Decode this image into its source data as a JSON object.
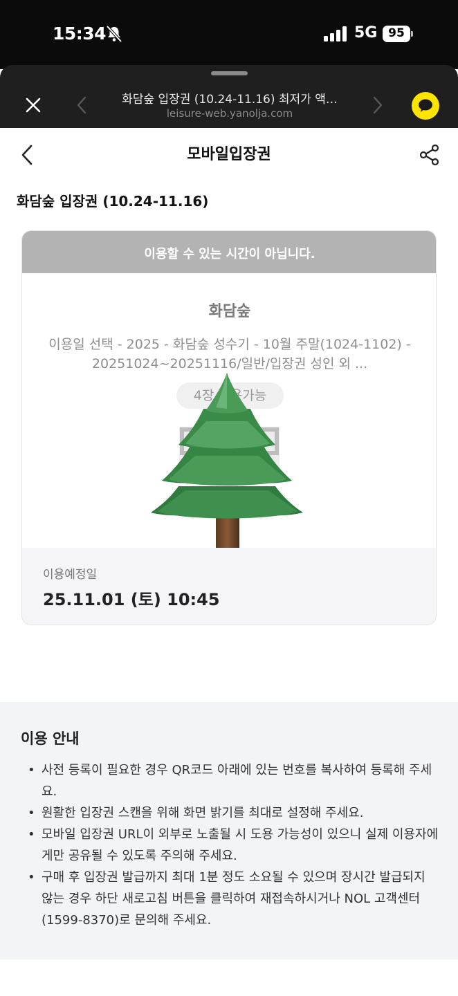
{
  "status_bar": {
    "time": "15:34",
    "network": "5G",
    "battery": "95"
  },
  "browser": {
    "title": "화담숲 입장권 (10.24-11.16) 최저가 액…",
    "url": "leisure-web.yanolja.com",
    "icons": [
      "close-icon",
      "chevron-left-icon",
      "chevron-right-icon",
      "kakao-chat-icon"
    ],
    "accent": "#fee500"
  },
  "header": {
    "title": "모바일입장권",
    "icons": [
      "back-chevron-icon",
      "share-icon"
    ]
  },
  "ticket": {
    "name": "화담숲 입장권 (10.24-11.16)",
    "banner": "이용할 수 있는 시간이 아닙니다.",
    "venue": "화담숲",
    "option": "이용일 선택 - 2025 - 화담숲 성수기 - 10월 주말(1024-1102) - 20251024~20251116/일반/입장권 성인 외 ...",
    "count": "4장 사용가능",
    "visit_label": "이용예정일",
    "visit_date": "25.11.01 (토) 10:45",
    "overlay_icon": "evergreen-tree-icon"
  },
  "info": {
    "title": "이용 안내",
    "items": [
      "사전 등록이 필요한 경우 QR코드 아래에 있는 번호를 복사하여 등록해 주세요.",
      "원활한 입장권 스캔을 위해 화면 밝기를 최대로 설정해 주세요.",
      "모바일 입장권 URL이 외부로 노출될 시 도용 가능성이 있으니 실제 이용자에게만 공유될 수 있도록 주의해 주세요.",
      "구매 후 입장권 발급까지 최대 1분 정도 소요될 수 있으며 장시간 발급되지 않는 경우 하단 새로고침 버튼을 클릭하여 재접속하시거나 NOL 고객센터(1599-8370)로 문의해 주세요."
    ]
  }
}
